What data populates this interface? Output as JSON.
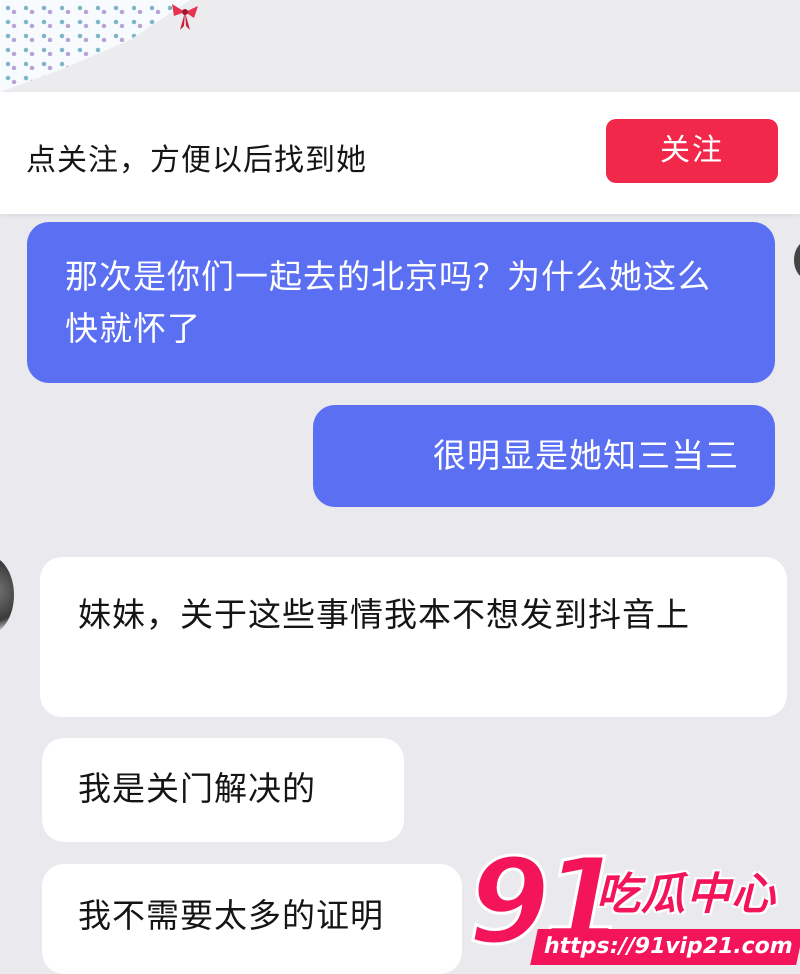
{
  "follow_bar": {
    "prompt": "点关注，方便以后找到她",
    "button_label": "关注",
    "button_color": "#f2284a"
  },
  "messages": [
    {
      "side": "sent",
      "text": "那次是你们一起去的北京吗？为什么她这么快就怀了"
    },
    {
      "side": "sent",
      "text": "很明显是她知三当三"
    },
    {
      "side": "received",
      "text": "妹妹，关于这些事情我本不想发到抖音上"
    },
    {
      "side": "received",
      "text": "我是关门解决的"
    },
    {
      "side": "received",
      "text": "我不需要太多的证明"
    }
  ],
  "colors": {
    "sent_bubble": "#5a6ff2",
    "received_bubble": "#ffffff",
    "background": "#e9e9ee"
  },
  "watermark": {
    "number": "91",
    "brand": "吃瓜中心",
    "url": "https://91vip21.com"
  }
}
